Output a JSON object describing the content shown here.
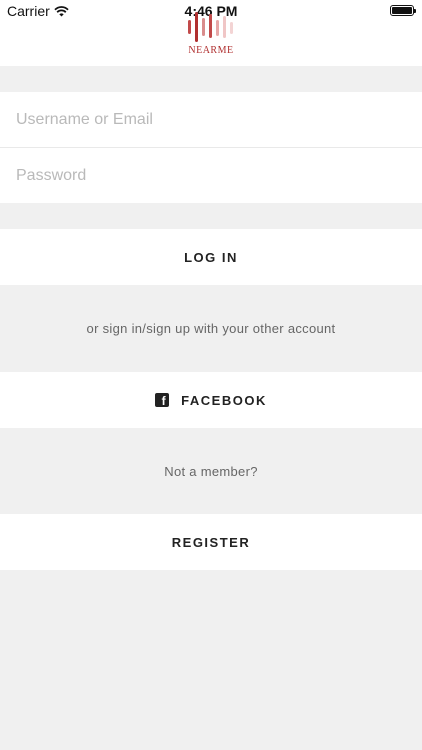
{
  "status_bar": {
    "carrier": "Carrier",
    "time": "4:46 PM",
    "icons": [
      "wifi-icon",
      "battery-icon"
    ]
  },
  "header": {
    "logo_text": "NEARME",
    "logo_colors": [
      "#c24a4a",
      "#d98c8c",
      "#f0c6c6"
    ]
  },
  "form": {
    "username_placeholder": "Username or Email",
    "password_placeholder": "Password",
    "login_label": "LOG IN"
  },
  "social": {
    "divider_text": "or sign in/sign up with your other account",
    "facebook_label": "FACEBOOK",
    "facebook_icon": "facebook-icon"
  },
  "register": {
    "prompt": "Not a member?",
    "register_label": "REGISTER"
  }
}
